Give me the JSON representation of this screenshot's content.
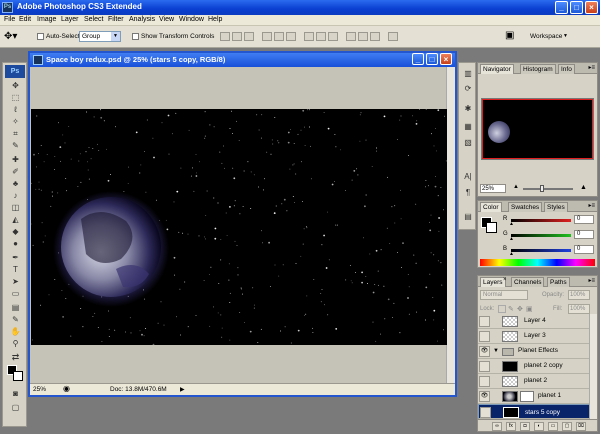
{
  "app": {
    "title": "Adobe Photoshop CS3 Extended",
    "logo": "Ps"
  },
  "menu": [
    "File",
    "Edit",
    "Image",
    "Layer",
    "Select",
    "Filter",
    "Analysis",
    "View",
    "Window",
    "Help"
  ],
  "options": {
    "auto_select_label": "Auto-Select:",
    "auto_select_value": "Group",
    "show_transform_label": "Show Transform Controls",
    "workspace_label": "Workspace"
  },
  "document": {
    "title": "Space boy redux.psd @ 25% (stars 5 copy, RGB/8)",
    "zoom": "25%",
    "doc_info": "Doc: 13.8M/470.6M"
  },
  "navigator": {
    "tabs": [
      "Navigator",
      "Histogram",
      "Info"
    ],
    "zoom": "25%"
  },
  "color": {
    "tabs": [
      "Color",
      "Swatches",
      "Styles"
    ],
    "channels": [
      {
        "label": "R",
        "value": "0",
        "color": "#e02020"
      },
      {
        "label": "G",
        "value": "0",
        "color": "#20c020"
      },
      {
        "label": "B",
        "value": "0",
        "color": "#2040e0"
      }
    ]
  },
  "layers": {
    "tabs": [
      "Layers",
      "Channels",
      "Paths"
    ],
    "blend_mode": "Normal",
    "opacity_label": "Opacity:",
    "opacity_value": "100%",
    "lock_label": "Lock:",
    "fill_label": "Fill:",
    "fill_value": "100%",
    "rows": [
      {
        "name": "Layer 4",
        "visible": false,
        "selected": false
      },
      {
        "name": "Layer 3",
        "visible": false,
        "selected": false
      },
      {
        "name": "Planet Effects",
        "visible": true,
        "selected": false,
        "group": true
      },
      {
        "name": "planet 2 copy",
        "visible": false,
        "selected": false
      },
      {
        "name": "planet 2",
        "visible": false,
        "selected": false
      },
      {
        "name": "planet 1",
        "visible": true,
        "selected": false
      },
      {
        "name": "stars 5 copy",
        "visible": false,
        "selected": true
      }
    ]
  },
  "colors": {
    "xp_blue": "#0a3fd0",
    "panel_bg": "#d6d3c6",
    "selection": "#0a246a"
  }
}
